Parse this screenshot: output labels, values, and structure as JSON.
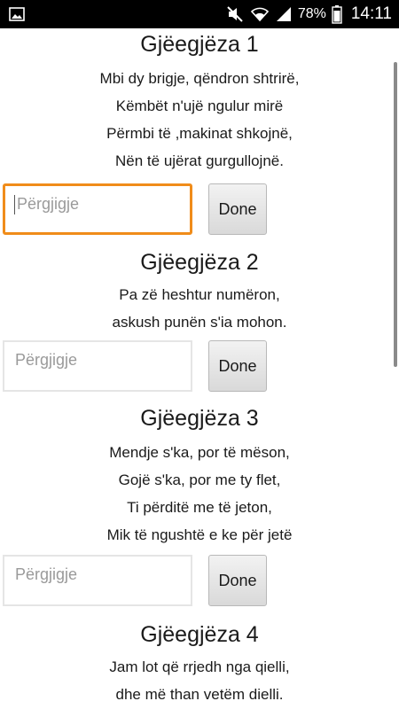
{
  "status_bar": {
    "battery": "78%",
    "time": "14:11",
    "icons": [
      "image-icon",
      "mute-icon",
      "wifi-icon",
      "signal-icon",
      "battery-icon"
    ]
  },
  "riddles": [
    {
      "title": "Gjëegjëza 1",
      "lines": [
        "Mbi dy brigje, qëndron shtrirë,",
        "Këmbët n'ujë ngulur mirë",
        "Përmbi të ,makinat shkojnë,",
        "Nën të ujërat gurgullojnë."
      ],
      "answer_placeholder": "Përgjigje",
      "done_label": "Done",
      "focused": true
    },
    {
      "title": "Gjëegjëza 2",
      "lines": [
        "Pa zë heshtur numëron,",
        "askush punën s'ia mohon."
      ],
      "answer_placeholder": "Përgjigje",
      "done_label": "Done",
      "focused": false
    },
    {
      "title": "Gjëegjëza 3",
      "lines": [
        "Mendje s'ka, por të mëson,",
        "Gojë s'ka, por me ty flet,",
        "Ti përditë me të jeton,",
        "Mik të ngushtë e ke për jetë"
      ],
      "answer_placeholder": "Përgjigje",
      "done_label": "Done",
      "focused": false
    },
    {
      "title": "Gjëegjëza 4",
      "lines": [
        "Jam lot që rrjedh nga qielli,",
        "dhe më than vetëm dielli."
      ]
    }
  ]
}
